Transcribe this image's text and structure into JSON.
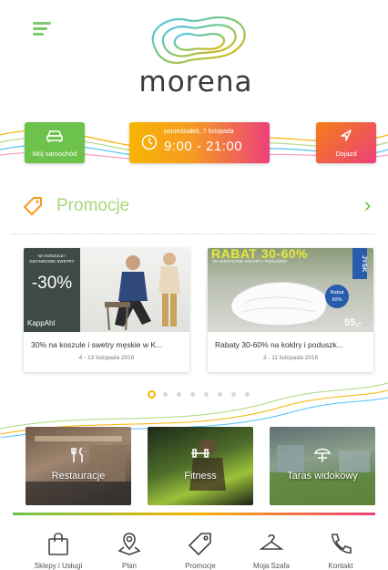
{
  "header": {
    "brand": "morena"
  },
  "status": {
    "car_label": "Mój samochód",
    "date": "poniedziałek, 7 listopada",
    "hours": "9:00 - 21:00",
    "directions_label": "Dojazd"
  },
  "promotions": {
    "title": "Promocje",
    "cards": [
      {
        "title": "30% na koszule i swetry męskie w K...",
        "dates": "4 - 13 listopada 2016",
        "image_text": {
          "headline": "NA KOSZULE I DZIANINOWE SWETRY",
          "discount": "-30%",
          "brand": "KappAhl"
        }
      },
      {
        "title": "Rabaty 30-60% na kołdry i poduszk...",
        "dates": "3 - 11 listopada 2016",
        "image_text": {
          "banner": "RABAT 30-60%",
          "sub": "NA WSZYSTKIE KOŁDRY I PODUSZKI*",
          "badge": "Rabat 60%",
          "brand": "JYSK",
          "price": "55,-"
        }
      }
    ],
    "carousel": {
      "total": 8,
      "active": 0
    }
  },
  "features": [
    {
      "label": "Restauracje",
      "icon": "cutlery-icon"
    },
    {
      "label": "Fitness",
      "icon": "dumbbell-icon"
    },
    {
      "label": "Taras widokowy",
      "icon": "umbrella-table-icon"
    }
  ],
  "bottom_nav": [
    {
      "label": "Sklepy i Usługi",
      "icon": "shopping-bag-icon"
    },
    {
      "label": "Plan",
      "icon": "map-pin-icon"
    },
    {
      "label": "Promocje",
      "icon": "tag-icon"
    },
    {
      "label": "Moja Szafa",
      "icon": "hanger-icon"
    },
    {
      "label": "Kontakt",
      "icon": "phone-icon"
    }
  ],
  "colors": {
    "green": "#6cc24a",
    "orange": "#f59a23",
    "pink": "#ec407a",
    "yellow": "#f5b400"
  }
}
